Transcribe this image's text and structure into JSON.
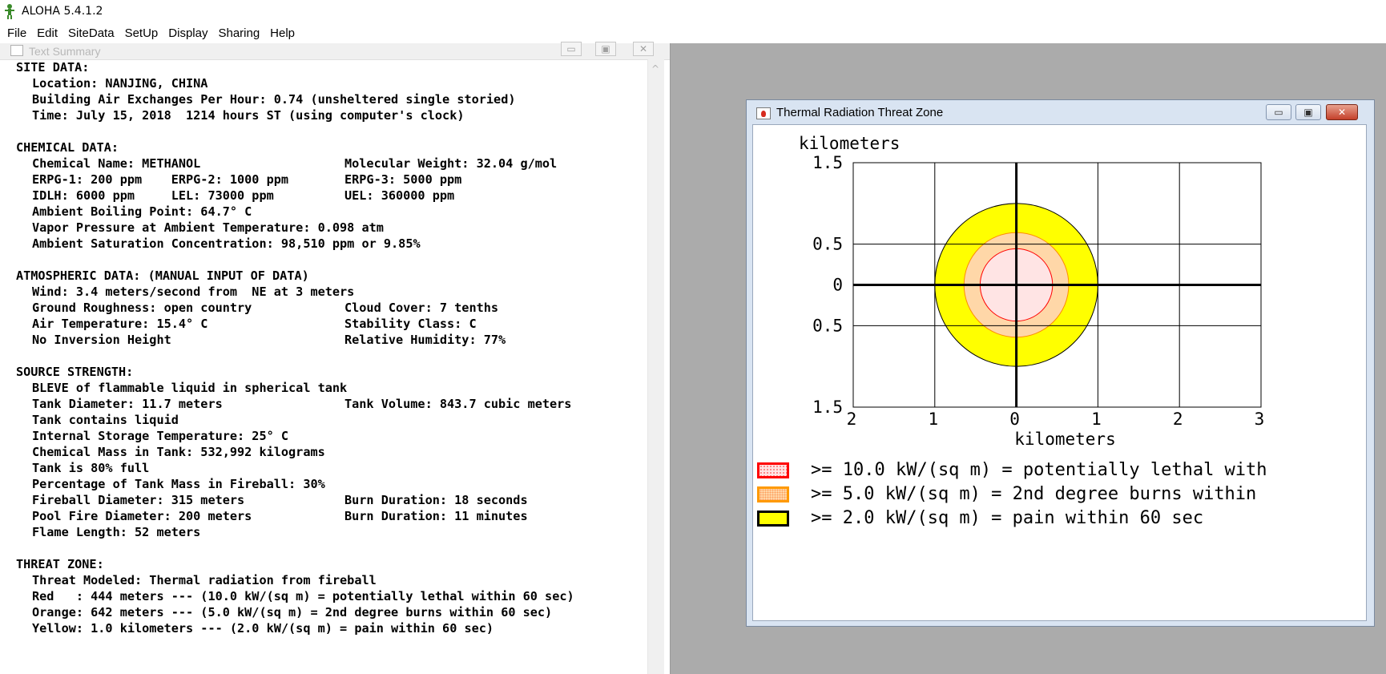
{
  "app": {
    "title": "ALOHA 5.4.1.2"
  },
  "menu": [
    "File",
    "Edit",
    "SiteData",
    "SetUp",
    "Display",
    "Sharing",
    "Help"
  ],
  "text_summary": {
    "title": "Text Summary",
    "sections": [
      {
        "heading": "SITE DATA:",
        "rows": [
          [
            "Location: NANJING, CHINA",
            ""
          ],
          [
            "Building Air Exchanges Per Hour: 0.74 (unsheltered single storied)",
            ""
          ],
          [
            "Time: July 15, 2018  1214 hours ST (using computer's clock)",
            ""
          ]
        ]
      },
      {
        "heading": "CHEMICAL DATA:",
        "rows": [
          [
            "Chemical Name: METHANOL",
            "Molecular Weight: 32.04 g/mol"
          ],
          [
            "ERPG-1: 200 ppm    ERPG-2: 1000 ppm",
            "ERPG-3: 5000 ppm"
          ],
          [
            "IDLH: 6000 ppm     LEL: 73000 ppm",
            "UEL: 360000 ppm"
          ],
          [
            "Ambient Boiling Point: 64.7° C",
            ""
          ],
          [
            "Vapor Pressure at Ambient Temperature: 0.098 atm",
            ""
          ],
          [
            "Ambient Saturation Concentration: 98,510 ppm or 9.85%",
            ""
          ]
        ]
      },
      {
        "heading": "ATMOSPHERIC DATA: (MANUAL INPUT OF DATA)",
        "rows": [
          [
            "Wind: 3.4 meters/second from  NE at 3 meters",
            ""
          ],
          [
            "Ground Roughness: open country",
            "Cloud Cover: 7 tenths"
          ],
          [
            "Air Temperature: 15.4° C",
            "Stability Class: C"
          ],
          [
            "No Inversion Height",
            "Relative Humidity: 77%"
          ]
        ]
      },
      {
        "heading": "SOURCE STRENGTH:",
        "rows": [
          [
            "BLEVE of flammable liquid in spherical tank",
            ""
          ],
          [
            "Tank Diameter: 11.7 meters",
            "Tank Volume: 843.7 cubic meters"
          ],
          [
            "Tank contains liquid",
            ""
          ],
          [
            "Internal Storage Temperature: 25° C",
            ""
          ],
          [
            "Chemical Mass in Tank: 532,992 kilograms",
            ""
          ],
          [
            "Tank is 80% full",
            ""
          ],
          [
            "Percentage of Tank Mass in Fireball: 30%",
            ""
          ],
          [
            "Fireball Diameter: 315 meters",
            "Burn Duration: 18 seconds"
          ],
          [
            "Pool Fire Diameter: 200 meters",
            "Burn Duration: 11 minutes"
          ],
          [
            "Flame Length: 52 meters",
            ""
          ]
        ]
      },
      {
        "heading": "THREAT ZONE:",
        "rows": [
          [
            "Threat Modeled: Thermal radiation from fireball",
            ""
          ],
          [
            "Red   : 444 meters --- (10.0 kW/(sq m) = potentially lethal within 60 sec)",
            ""
          ],
          [
            "Orange: 642 meters --- (5.0 kW/(sq m) = 2nd degree burns within 60 sec)",
            ""
          ],
          [
            "Yellow: 1.0 kilometers --- (2.0 kW/(sq m) = pain within 60 sec)",
            ""
          ]
        ]
      }
    ]
  },
  "threat_window": {
    "title": "Thermal Radiation Threat Zone",
    "legend": [
      {
        "text": ">= 10.0 kW/(sq m) = potentially lethal with",
        "fill": "#ffe4e4",
        "border": "#ff0000"
      },
      {
        "text": ">= 5.0 kW/(sq m) = 2nd degree burns within",
        "fill": "#ffd7a8",
        "border": "#ff9900"
      },
      {
        "text": ">= 2.0 kW/(sq m) = pain within 60 sec",
        "fill": "#ffff00",
        "border": "#000000"
      }
    ]
  },
  "chart_data": {
    "type": "heatmap",
    "ylabel": "kilometers",
    "xlabel": "kilometers",
    "x_ticks": [
      "2",
      "1",
      "0",
      "1",
      "2",
      "3"
    ],
    "x_tick_values": [
      -2,
      -1,
      0,
      1,
      2,
      3
    ],
    "y_ticks": [
      "1.5",
      "0.5",
      "0",
      "0.5",
      "1.5"
    ],
    "y_tick_values": [
      1.5,
      0.5,
      0,
      -0.5,
      -1.5
    ],
    "xlim": [
      -2,
      3
    ],
    "ylim": [
      -1.5,
      1.5
    ],
    "grid": true,
    "zones": [
      {
        "name": "Yellow",
        "radius_km": 1.0,
        "color": "#ffff00"
      },
      {
        "name": "Orange",
        "radius_km": 0.642,
        "color": "#ffd7a8"
      },
      {
        "name": "Red",
        "radius_km": 0.444,
        "color": "#ffe4e4"
      }
    ]
  }
}
